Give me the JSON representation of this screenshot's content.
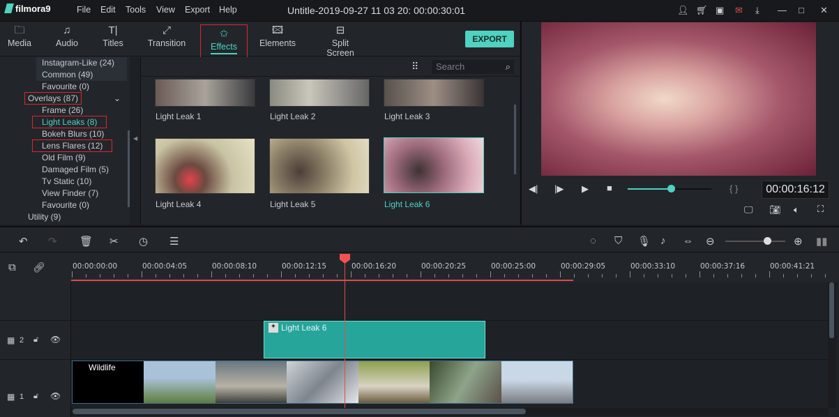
{
  "app": {
    "logo": "filmora9",
    "title": "Untitle-2019-09-27 11 03 20: 00:00:30:01",
    "menu": [
      "File",
      "Edit",
      "Tools",
      "View",
      "Export",
      "Help"
    ]
  },
  "window_icons": [
    "user-icon",
    "cart-icon",
    "save-icon",
    "mail-icon",
    "download-icon",
    "minimize-icon",
    "maximize-icon",
    "close-icon"
  ],
  "tabs": [
    {
      "label": "Media",
      "icon": "folder-icon"
    },
    {
      "label": "Audio",
      "icon": "music-icon"
    },
    {
      "label": "Titles",
      "icon": "titles-icon"
    },
    {
      "label": "Transition",
      "icon": "transition-icon"
    },
    {
      "label": "Effects",
      "icon": "effects-icon",
      "active": true
    },
    {
      "label": "Elements",
      "icon": "image-icon"
    },
    {
      "label": "Split Screen",
      "icon": "split-screen-icon"
    }
  ],
  "export_label": "EXPORT",
  "categories": [
    {
      "label": "Instagram-Like (24)"
    },
    {
      "label": "Common (49)"
    },
    {
      "label": "Favourite (0)"
    },
    {
      "label": "Overlays (87)",
      "highlighted": true
    },
    {
      "label": "Frame (26)"
    },
    {
      "label": "Light Leaks (8)",
      "highlighted": true,
      "selected": true
    },
    {
      "label": "Bokeh Blurs (10)"
    },
    {
      "label": "Lens Flares (12)",
      "highlighted": true
    },
    {
      "label": "Old Film (9)"
    },
    {
      "label": "Damaged Film (5)"
    },
    {
      "label": "Tv Static (10)"
    },
    {
      "label": "View Finder (7)"
    },
    {
      "label": "Favourite (0)"
    },
    {
      "label": "Utility (9)"
    }
  ],
  "search": {
    "placeholder": "Search"
  },
  "effects": [
    {
      "label": "Light Leak 1"
    },
    {
      "label": "Light Leak 2"
    },
    {
      "label": "Light Leak 3"
    },
    {
      "label": "Light Leak 4"
    },
    {
      "label": "Light Leak 5"
    },
    {
      "label": "Light Leak 6",
      "selected": true
    }
  ],
  "player": {
    "timecode": "00:00:16:12",
    "progress": 0.52
  },
  "timeline": {
    "ruler": [
      "00:00:00:00",
      "00:00:04:05",
      "00:00:08:10",
      "00:00:12:15",
      "00:00:16:20",
      "00:00:20:25",
      "00:00:25:00",
      "00:00:29:05",
      "00:00:33:10",
      "00:00:37:16",
      "00:00:41:21"
    ],
    "zoom_level": 0.7,
    "tracks": [
      {
        "number": "2",
        "clip": "Light Leak 6"
      },
      {
        "number": "1",
        "clip": "Wildlife"
      }
    ]
  },
  "colors": {
    "accent": "#4fd2c0",
    "playhead": "#f05252",
    "clip_effect": "#26a59a"
  }
}
